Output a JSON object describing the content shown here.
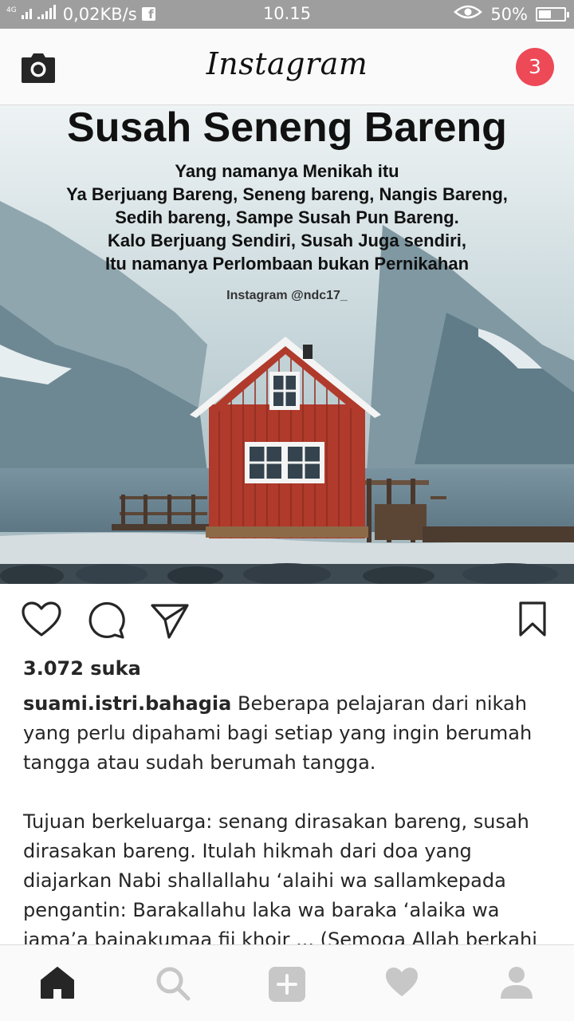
{
  "status_bar": {
    "network": "4G",
    "speed": "0,02KB/s",
    "time": "10.15",
    "battery": "50%",
    "battery_level": 0.5,
    "icons": [
      "signal-icon",
      "facebook-icon",
      "eye-icon",
      "battery-icon"
    ]
  },
  "header": {
    "logo": "Instagram",
    "badge_count": "3",
    "badge_color": "#ed4956",
    "icons": [
      "camera-icon"
    ]
  },
  "post": {
    "image": {
      "title": "Susah Seneng Bareng",
      "lines": [
        "Yang namanya Menikah itu",
        "Ya Berjuang Bareng, Seneng bareng, Nangis Bareng,",
        "Sedih bareng, Sampe Susah Pun Bareng.",
        "Kalo Berjuang Sendiri, Susah Juga sendiri,",
        "Itu namanya Perlombaan bukan Pernikahan"
      ],
      "handle": "Instagram @ndc17_"
    },
    "actions": [
      "heart-icon",
      "comment-icon",
      "share-icon",
      "bookmark-icon"
    ],
    "likes": "3.072 suka",
    "caption": {
      "username": "suami.istri.bahagia",
      "text1": "Beberapa pelajaran dari nikah yang perlu dipahami bagi setiap yang ingin berumah tangga atau sudah berumah tangga.",
      "text2": "Tujuan berkeluarga: senang dirasakan bareng, susah dirasakan bareng. Itulah hikmah dari doa yang diajarkan Nabi shallallahu ‘alaihi wa sallamkepada pengantin: Barakallahu laka wa baraka ‘alaika wa jama’a bainakumaa fii khoir ... (Semoga Allah berkahi"
    }
  },
  "bottom_nav": {
    "items": [
      "home-icon",
      "search-icon",
      "add-icon",
      "activity-icon",
      "profile-icon"
    ]
  }
}
